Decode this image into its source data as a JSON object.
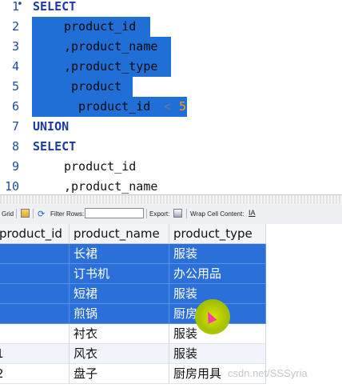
{
  "editor": {
    "lines": [
      {
        "num": "1",
        "fold": "•",
        "text": "SELECT",
        "kind": "keyword"
      },
      {
        "num": "2",
        "text": "product_id",
        "kind": "selected"
      },
      {
        "num": "3",
        "text": ",product_name",
        "kind": "selected"
      },
      {
        "num": "4",
        "text": ",product_type",
        "kind": "selected"
      },
      {
        "num": "5",
        "text": "product",
        "kind": "selected"
      },
      {
        "num": "6",
        "text": "product_id",
        "op": "<",
        "value": "5",
        "kind": "selected"
      },
      {
        "num": "7",
        "text": "UNION",
        "kind": "keyword"
      },
      {
        "num": "8",
        "text": "SELECT",
        "kind": "keyword"
      },
      {
        "num": "9",
        "text": "product_id",
        "kind": "plain"
      },
      {
        "num": "10",
        "text": ",product_name",
        "kind": "plain"
      }
    ]
  },
  "toolbar": {
    "grid_label": "Grid",
    "filter_label": "Filter Rows:",
    "filter_value": "",
    "export_label": "Export:",
    "wrap_label": "Wrap Cell Content:",
    "wrap_icon": "IA"
  },
  "grid": {
    "columns": [
      "product_id",
      "product_name",
      "product_type"
    ],
    "rows": [
      {
        "id": "",
        "name": "长裙",
        "type": "服装",
        "selected": true
      },
      {
        "id": "",
        "name": "订书机",
        "type": "办公用品",
        "selected": true
      },
      {
        "id": "",
        "name": "短裙",
        "type": "服装",
        "selected": true
      },
      {
        "id": "",
        "name": "煎锅",
        "type": "厨房用具",
        "selected": true
      },
      {
        "id": "",
        "name": "衬衣",
        "type": "服装",
        "selected": false
      },
      {
        "id": "1",
        "name": "风衣",
        "type": "服装",
        "selected": false
      },
      {
        "id": "2",
        "name": "盘子",
        "type": "厨房用具",
        "selected": false
      }
    ]
  },
  "watermark": "csdn.net/SSSyria"
}
